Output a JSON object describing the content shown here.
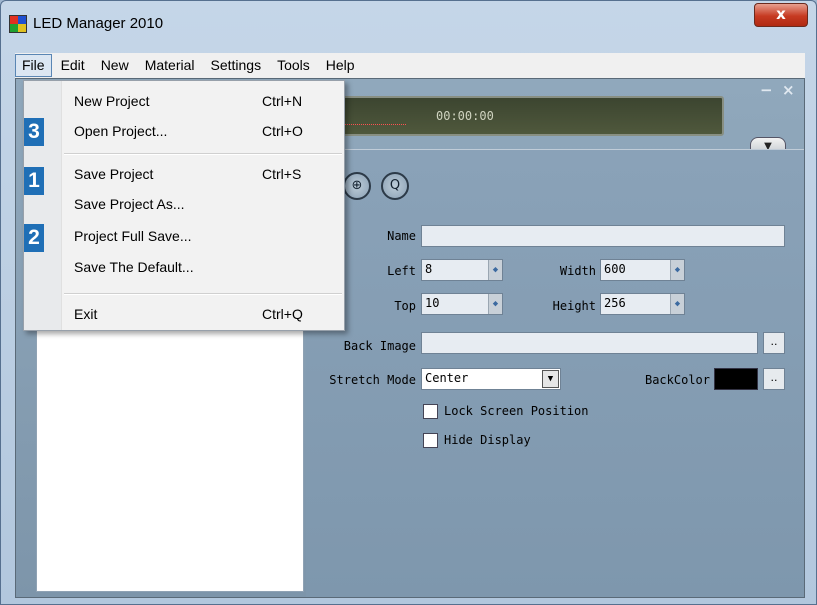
{
  "window": {
    "title": "LED Manager 2010",
    "close_glyph": "x"
  },
  "menubar": {
    "items": [
      {
        "label": "File"
      },
      {
        "label": "Edit"
      },
      {
        "label": "New"
      },
      {
        "label": "Material"
      },
      {
        "label": "Settings"
      },
      {
        "label": "Tools"
      },
      {
        "label": "Help"
      }
    ]
  },
  "player": {
    "time": "00:00:00"
  },
  "panel_controls": {
    "minimize": "−",
    "close": "×",
    "dropdown": "▼"
  },
  "zoom": {
    "in": "⊕",
    "out": "Q"
  },
  "properties": {
    "name_label": "Name",
    "name_value": "",
    "left_label": "Left",
    "left_value": "8",
    "width_label": "Width",
    "width_value": "600",
    "top_label": "Top",
    "top_value": "10",
    "height_label": "Height",
    "height_value": "256",
    "back_image_label": "Back Image",
    "back_image_value": "",
    "browse_glyph": "..",
    "stretch_mode_label": "Stretch Mode",
    "stretch_mode_value": "Center",
    "back_color_label": "BackColor",
    "back_color": "#000000",
    "lock_screen_label": "Lock Screen Position",
    "lock_screen_checked": false,
    "hide_display_label": "Hide Display",
    "hide_display_checked": false
  },
  "file_menu": {
    "items": [
      {
        "label": "New Project",
        "shortcut": "Ctrl+N"
      },
      {
        "label": "Open Project...",
        "shortcut": "Ctrl+O",
        "step": "3"
      },
      {
        "label": "Save Project",
        "shortcut": "Ctrl+S",
        "step": "1"
      },
      {
        "label": "Save Project As...",
        "shortcut": ""
      },
      {
        "label": "Project Full Save...",
        "shortcut": "",
        "step": "2"
      },
      {
        "label": "Save The Default...",
        "shortcut": ""
      },
      {
        "label": "Exit",
        "shortcut": "Ctrl+Q"
      }
    ]
  },
  "colors": {
    "accent_badge": "#1f6fb6",
    "close_button": "#c63a22"
  }
}
